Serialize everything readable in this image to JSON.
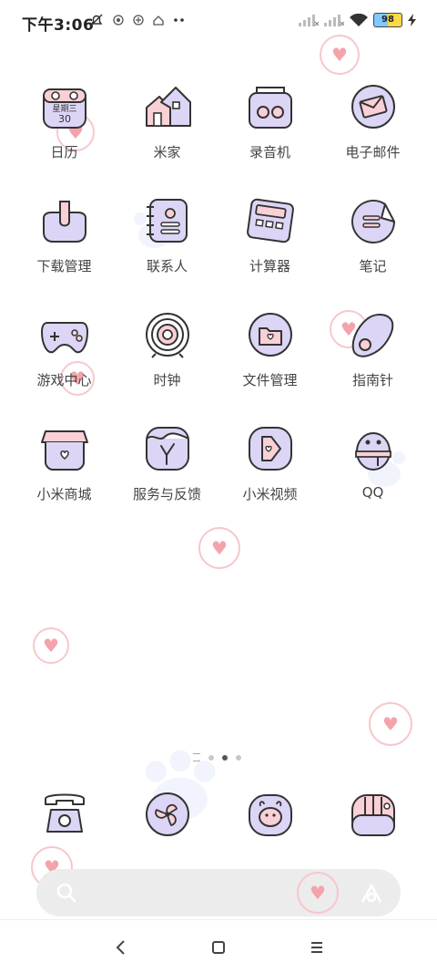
{
  "status_bar": {
    "time": "下午3:06",
    "battery": "98"
  },
  "apps": [
    {
      "label": "日历",
      "icon": "calendar-icon",
      "name": "app-calendar",
      "cal_line1": "星期三",
      "cal_line2": "30"
    },
    {
      "label": "米家",
      "icon": "houses-icon",
      "name": "app-mijia"
    },
    {
      "label": "录音机",
      "icon": "recorder-icon",
      "name": "app-recorder"
    },
    {
      "label": "电子邮件",
      "icon": "mail-icon",
      "name": "app-email"
    },
    {
      "label": "下载管理",
      "icon": "download-icon",
      "name": "app-downloads"
    },
    {
      "label": "联系人",
      "icon": "contacts-icon",
      "name": "app-contacts"
    },
    {
      "label": "计算器",
      "icon": "calculator-icon",
      "name": "app-calculator"
    },
    {
      "label": "笔记",
      "icon": "notes-icon",
      "name": "app-notes"
    },
    {
      "label": "游戏中心",
      "icon": "gamepad-icon",
      "name": "app-game-center"
    },
    {
      "label": "时钟",
      "icon": "clock-icon",
      "name": "app-clock"
    },
    {
      "label": "文件管理",
      "icon": "folder-icon",
      "name": "app-file-manager"
    },
    {
      "label": "指南针",
      "icon": "compass-icon",
      "name": "app-compass"
    },
    {
      "label": "小米商城",
      "icon": "shop-icon",
      "name": "app-mi-store"
    },
    {
      "label": "服务与反馈",
      "icon": "feedback-icon",
      "name": "app-service-feedback"
    },
    {
      "label": "小米视频",
      "icon": "video-icon",
      "name": "app-mi-video"
    },
    {
      "label": "QQ",
      "icon": "qq-penguin-icon",
      "name": "app-qq"
    }
  ],
  "dock": [
    {
      "icon": "phone-icon",
      "name": "dock-phone"
    },
    {
      "icon": "fan-icon",
      "name": "dock-security"
    },
    {
      "icon": "chat-bubble-icon",
      "name": "dock-messages"
    },
    {
      "icon": "camera-icon",
      "name": "dock-camera"
    }
  ],
  "page_indicator": {
    "pages": 2,
    "active": 1
  },
  "colors": {
    "icon_fill": "#dcd5f5",
    "icon_pink": "#f9d0d6",
    "stroke": "#333333",
    "heart": "#f4a3ab"
  }
}
